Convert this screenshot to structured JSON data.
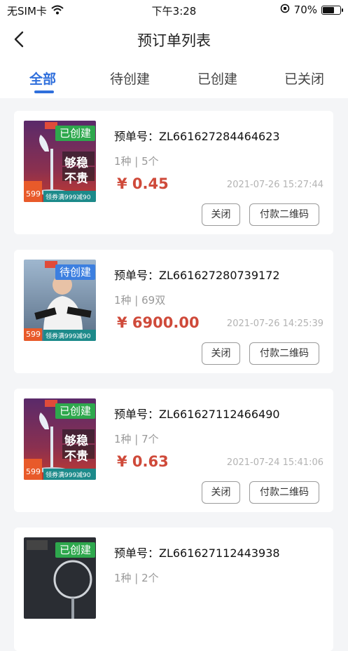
{
  "status_bar": {
    "carrier": "无SIM卡",
    "time": "下午3:28",
    "battery": "70%",
    "battery_level": 0.7
  },
  "header": {
    "title": "预订单列表"
  },
  "tabs": [
    {
      "label": "全部"
    },
    {
      "label": "待创建"
    },
    {
      "label": "已创建"
    },
    {
      "label": "已关闭"
    }
  ],
  "active_tab": "全部",
  "orders": [
    {
      "order_no": "预单号：ZL661627284464623",
      "status": "已创建",
      "qty": "1种 | 5个",
      "price": "¥ 0.45",
      "date": "2021-07-26 15:27:44",
      "thumb_text": [
        "够稳",
        "不贵",
        "599",
        "领券满999减90"
      ],
      "close_label": "关闭",
      "qr_label": "付款二维码"
    },
    {
      "order_no": "预单号：ZL661627280739172",
      "status": "待创建",
      "qty": "1种 | 69双",
      "price": "¥ 6900.00",
      "date": "2021-07-26 14:25:39",
      "thumb_text": [
        "",
        "",
        "599",
        "领券满999减90"
      ],
      "close_label": "关闭",
      "qr_label": "付款二维码"
    },
    {
      "order_no": "预单号：ZL661627112466490",
      "status": "已创建",
      "qty": "1种 | 7个",
      "price": "¥ 0.63",
      "date": "2021-07-24 15:41:06",
      "thumb_text": [
        "够稳",
        "不贵",
        "599",
        "领券满999减90"
      ],
      "close_label": "关闭",
      "qr_label": "付款二维码"
    },
    {
      "order_no": "预单号：ZL661627112443938",
      "status": "已创建",
      "qty": "1种 | 2个",
      "price": "",
      "date": "",
      "thumb_text": [
        "",
        "",
        "",
        ""
      ],
      "close_label": "",
      "qr_label": ""
    }
  ],
  "colors": {
    "accent": "#2f6fdc",
    "price": "#cf4a3a",
    "badge": "#2ea84d",
    "background": "#f4f5f7"
  }
}
